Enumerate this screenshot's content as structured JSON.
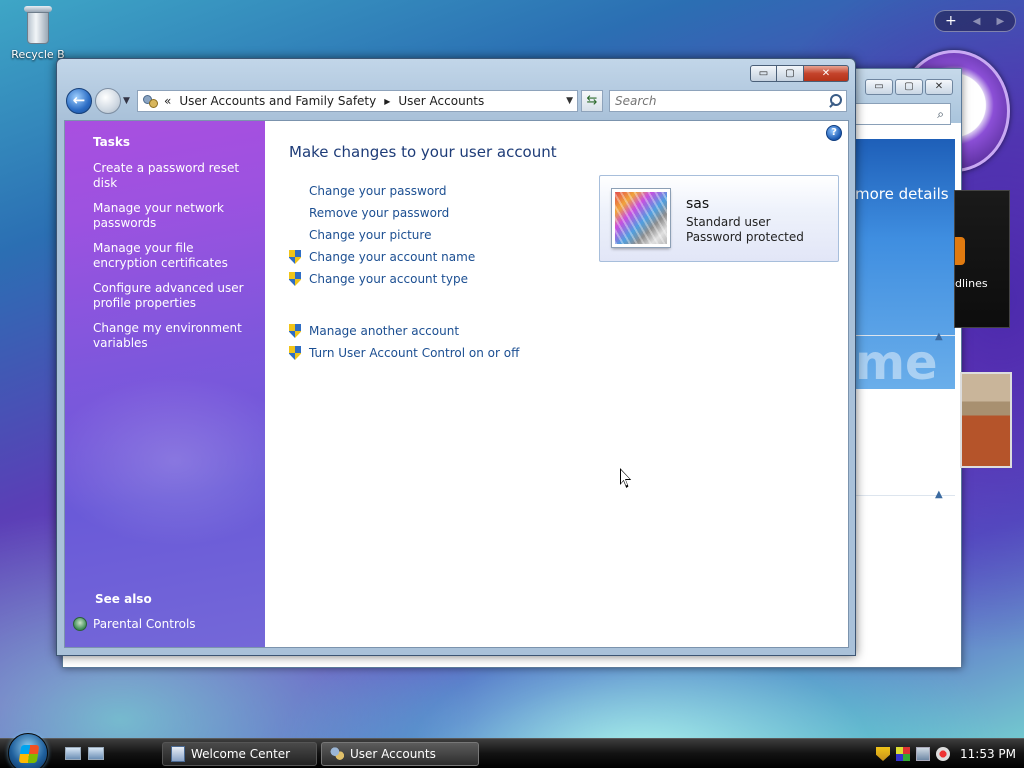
{
  "desktop": {
    "recycle_bin_label": "Recycle B"
  },
  "back_window": {
    "banner_text": "more details",
    "banner_big": "me",
    "headlines_text": "dlines"
  },
  "window": {
    "controls": {
      "min": "▭",
      "max": "▢",
      "close": "✕"
    },
    "nav": {
      "back": "←",
      "forward": ""
    },
    "address": {
      "chevron": "«",
      "crumbs": [
        "User Accounts and Family Safety",
        "User Accounts"
      ]
    },
    "search": {
      "placeholder": "Search"
    }
  },
  "task_pane": {
    "heading": "Tasks",
    "tasks": [
      "Create a password reset disk",
      "Manage your network passwords",
      "Manage your file encryption certificates",
      "Configure advanced user profile properties",
      "Change my environment variables"
    ],
    "see_also_heading": "See also",
    "see_also": [
      "Parental Controls"
    ]
  },
  "content": {
    "title": "Make changes to your user account",
    "links_group1": [
      {
        "label": "Change your password",
        "shield": false
      },
      {
        "label": "Remove your password",
        "shield": false
      },
      {
        "label": "Change your picture",
        "shield": false
      },
      {
        "label": "Change your account name",
        "shield": true
      },
      {
        "label": "Change your account type",
        "shield": true
      }
    ],
    "links_group2": [
      {
        "label": "Manage another account",
        "shield": true
      },
      {
        "label": "Turn User Account Control on or off",
        "shield": true
      }
    ],
    "account": {
      "name": "sas",
      "type": "Standard user",
      "password_status": "Password protected"
    }
  },
  "taskbar": {
    "buttons": [
      "Welcome Center",
      "User Accounts"
    ],
    "active_button": "User Accounts",
    "clock": "11:53 PM"
  },
  "colors": {
    "link": "#1c4f92",
    "title": "#1e3c78",
    "task_pane_top": "#a94fe0",
    "task_pane_bottom": "#7468d8"
  }
}
